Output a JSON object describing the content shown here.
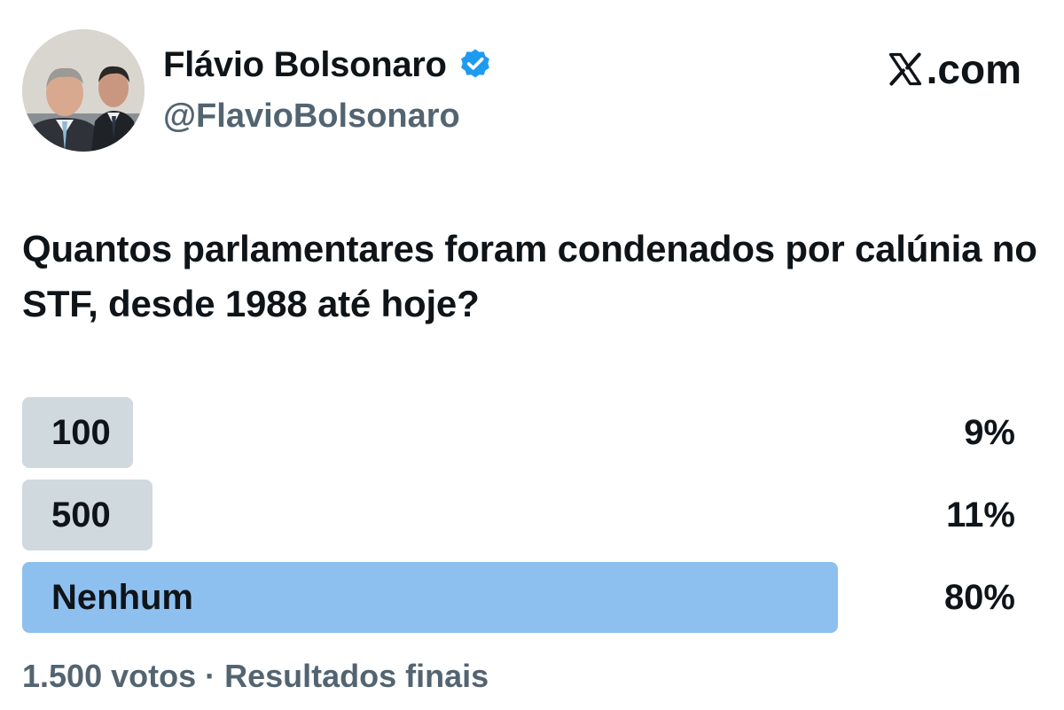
{
  "author": {
    "display_name": "Flávio Bolsonaro",
    "handle": "@FlavioBolsonaro",
    "verified_icon": "verified-badge-icon",
    "verified_color": "#1d9bf0"
  },
  "brand": {
    "label": ".com",
    "icon": "x-logo-icon"
  },
  "post": {
    "question": "Quantos parlamentares foram condenados por calúnia no STF, desde 1988 até hoje?"
  },
  "poll": {
    "options": [
      {
        "label": "100",
        "percent_text": "9%",
        "percent": 9,
        "winner": false
      },
      {
        "label": "500",
        "percent_text": "11%",
        "percent": 11,
        "winner": false
      },
      {
        "label": "Nenhum",
        "percent_text": "80%",
        "percent": 80,
        "winner": true
      }
    ],
    "footer": "1.500 votos · Resultados finais",
    "bar_color": "#cfd9de",
    "winner_bar_color": "#8ec0ef"
  }
}
